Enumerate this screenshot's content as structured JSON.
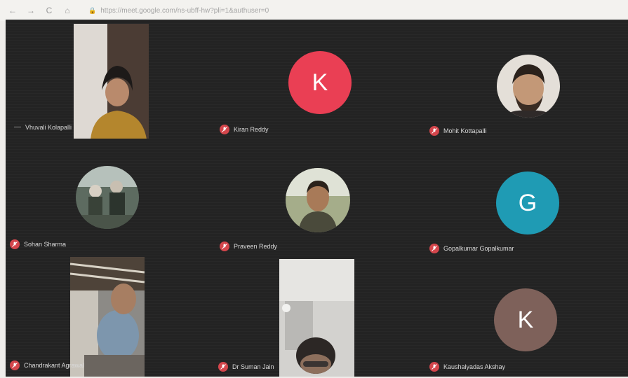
{
  "browser": {
    "back_icon": "←",
    "forward_icon": "→",
    "reload_icon": "C",
    "home_icon": "⌂",
    "lock_icon": "🔒",
    "url": "https://meet.google.com/ns-ubff-hw?pli=1&authuser=0"
  },
  "participants": [
    {
      "name": "Vhuvali Kolapalli",
      "tile_type": "video"
    },
    {
      "name": "Kiran Reddy",
      "tile_type": "letter",
      "letter": "K",
      "color": "#ea3f54"
    },
    {
      "name": "Mohit Kottapalli",
      "tile_type": "photo"
    },
    {
      "name": "Sohan Sharma",
      "tile_type": "photo"
    },
    {
      "name": "Praveen Reddy",
      "tile_type": "photo"
    },
    {
      "name": "Gopalkumar Gopalkumar",
      "tile_type": "letter",
      "letter": "G",
      "color": "#1f9bb4"
    },
    {
      "name": "Chandrakant Agrawal",
      "tile_type": "video"
    },
    {
      "name": "Dr Suman Jain",
      "tile_type": "video"
    },
    {
      "name": "Kaushalyadas Akshay",
      "tile_type": "letter",
      "letter": "K",
      "color": "#7e615a"
    }
  ],
  "icons": {
    "mic_off": "mic-off-icon"
  }
}
